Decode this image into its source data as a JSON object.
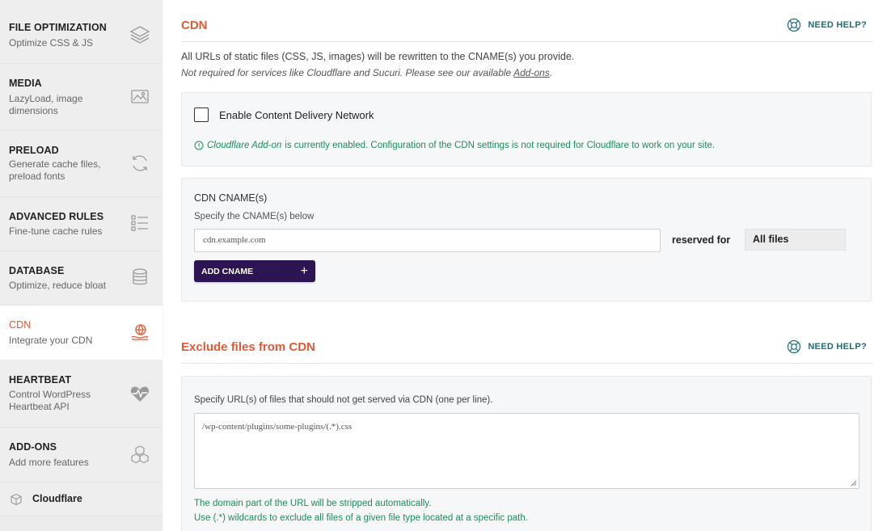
{
  "sidebar": {
    "items": [
      {
        "title": "FILE OPTIMIZATION",
        "desc": "Optimize CSS & JS",
        "icon": "layers-icon"
      },
      {
        "title": "MEDIA",
        "desc": "LazyLoad, image dimensions",
        "icon": "image-icon"
      },
      {
        "title": "PRELOAD",
        "desc": "Generate cache files, preload fonts",
        "icon": "refresh-icon"
      },
      {
        "title": "ADVANCED RULES",
        "desc": "Fine-tune cache rules",
        "icon": "list-icon"
      },
      {
        "title": "DATABASE",
        "desc": "Optimize, reduce bloat",
        "icon": "database-icon"
      },
      {
        "title": "CDN",
        "desc": "Integrate your CDN",
        "icon": "cdn-icon",
        "active": true
      },
      {
        "title": "HEARTBEAT",
        "desc": "Control WordPress Heartbeat API",
        "icon": "heartbeat-icon"
      },
      {
        "title": "ADD-ONS",
        "desc": "Add more features",
        "icon": "cubes-icon"
      }
    ],
    "cloudflare": {
      "label": "Cloudflare",
      "icon": "cube-icon"
    }
  },
  "cdn_section": {
    "title": "CDN",
    "help": "NEED HELP?",
    "intro": "All URLs of static files (CSS, JS, images) will be rewritten to the CNAME(s) you provide.",
    "intro2_before": "Not required for services like Cloudflare and Sucuri. Please see our available ",
    "intro2_link": "Add-ons",
    "intro2_after": ".",
    "enable_label": "Enable Content Delivery Network",
    "enable_checked": false,
    "notice_em": "Cloudflare Add-on",
    "notice_rest": " is currently enabled. Configuration of the CDN settings is not required for Cloudflare to work on your site."
  },
  "cname": {
    "label": "CDN CNAME(s)",
    "sub": "Specify the CNAME(s) below",
    "placeholder": "cdn.example.com",
    "reserved_label": "reserved for",
    "reserved_value": "All files",
    "add_button": "ADD CNAME",
    "add_plus": "+"
  },
  "exclude_section": {
    "title": "Exclude files from CDN",
    "help": "NEED HELP?",
    "label": "Specify URL(s) of files that should not get served via CDN (one per line).",
    "placeholder": "/wp-content/plugins/some-plugins/(.*).css",
    "note1": "The domain part of the URL will be stripped automatically.",
    "note2": "Use (.*) wildcards to exclude all files of a given file type located at a specific path."
  },
  "colors": {
    "accent": "#e05a35",
    "help": "#1e6c7a",
    "success": "#1e8e5a",
    "button": "#2d1453"
  }
}
